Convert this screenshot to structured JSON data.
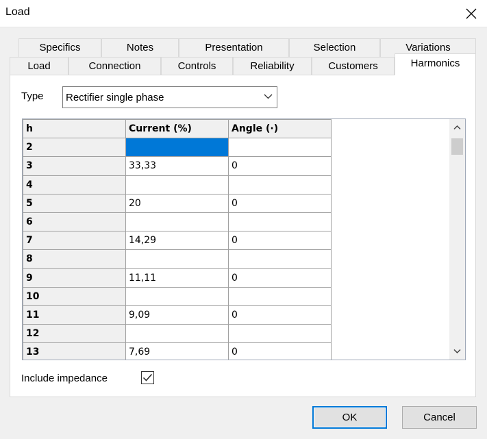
{
  "window": {
    "title": "Load"
  },
  "tabs": {
    "row_top": [
      {
        "label": "Specifics"
      },
      {
        "label": "Notes"
      },
      {
        "label": "Presentation"
      },
      {
        "label": "Selection"
      },
      {
        "label": "Variations"
      }
    ],
    "row_bottom": [
      {
        "label": "Load"
      },
      {
        "label": "Connection"
      },
      {
        "label": "Controls"
      },
      {
        "label": "Reliability"
      },
      {
        "label": "Customers"
      },
      {
        "label": "Harmonics"
      }
    ],
    "active": "Harmonics"
  },
  "type_field": {
    "label": "Type",
    "value": "Rectifier single phase"
  },
  "grid": {
    "columns": [
      "h",
      "Current (%)",
      "Angle (·)"
    ],
    "rows": [
      {
        "h": "2",
        "current": "",
        "angle": ""
      },
      {
        "h": "3",
        "current": "33,33",
        "angle": "0"
      },
      {
        "h": "4",
        "current": "",
        "angle": ""
      },
      {
        "h": "5",
        "current": "20",
        "angle": "0"
      },
      {
        "h": "6",
        "current": "",
        "angle": ""
      },
      {
        "h": "7",
        "current": "14,29",
        "angle": "0"
      },
      {
        "h": "8",
        "current": "",
        "angle": ""
      },
      {
        "h": "9",
        "current": "11,11",
        "angle": "0"
      },
      {
        "h": "10",
        "current": "",
        "angle": ""
      },
      {
        "h": "11",
        "current": "9,09",
        "angle": "0"
      },
      {
        "h": "12",
        "current": "",
        "angle": ""
      },
      {
        "h": "13",
        "current": "7,69",
        "angle": "0"
      }
    ]
  },
  "include_impedance": {
    "label": "Include impedance",
    "checked": true
  },
  "buttons": {
    "ok": "OK",
    "cancel": "Cancel"
  },
  "colors": {
    "selection": "#0078d7",
    "default_button_border": "#0078d7"
  }
}
